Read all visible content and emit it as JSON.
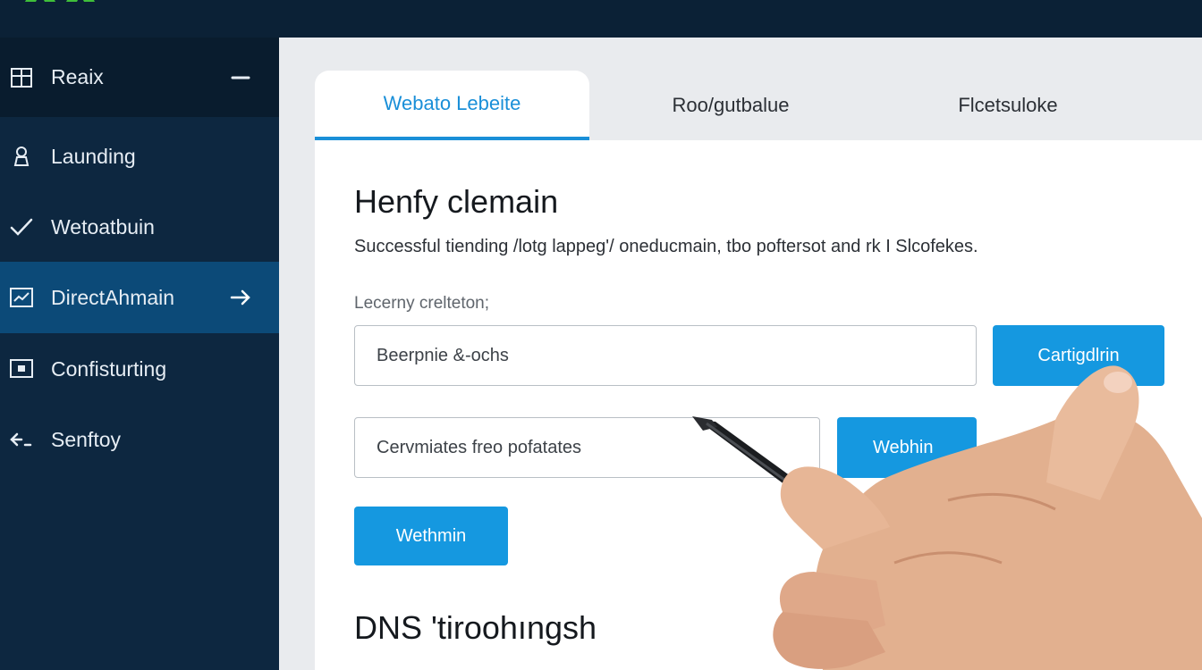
{
  "sidebar": {
    "items": [
      {
        "label": "Reaix",
        "icon": "building-icon"
      },
      {
        "label": "Launding",
        "icon": "user-icon"
      },
      {
        "label": "Wetoatbuin",
        "icon": "checkmark-icon"
      },
      {
        "label": "DirectAhmain",
        "icon": "chart-icon"
      },
      {
        "label": "Confisturting",
        "icon": "monitor-icon"
      },
      {
        "label": "Senftoy",
        "icon": "back-arrow-icon"
      }
    ]
  },
  "tabs": [
    "Webato Lebeite",
    "Roo/gutbalue",
    "Flcetsuloke"
  ],
  "main": {
    "title": "Henfy clemain",
    "subtitle": "Successful tiending /lotg lappeg'/ oneducmain, tbo poftersot and rk I Slcofekes.",
    "field_label": "Lecerny crelteton;",
    "input1_value": "Beerpnie &-ochs",
    "confirm_button": "Cartigdlrin",
    "input2_value": "Cervmiates freo pofatates",
    "secondary_button": "Webhin",
    "primary_button": "Wethmin",
    "section_title": "DNS 'tiroohıngsh"
  },
  "colors": {
    "topbar": "#0b2136",
    "sidebar": "#0d2740",
    "active_item": "#0c4a78",
    "accent": "#1598e0",
    "logo": "#3fbf3a"
  }
}
